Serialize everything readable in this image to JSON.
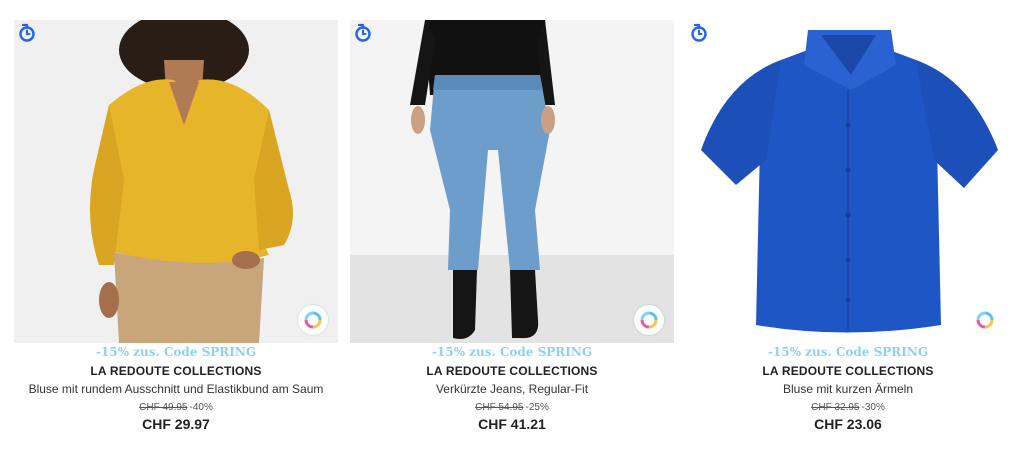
{
  "colors": {
    "accent_blue": "#2563eb",
    "promo_blue": "#8fd0f2"
  },
  "products": [
    {
      "promo": "-15% zus. Code SPRING",
      "brand": "LA REDOUTE COLLECTIONS",
      "title": "Bluse mit rundem Ausschnitt und Elastikbund am Saum",
      "old_price": "CHF 49.95",
      "discount": "-40%",
      "price": "CHF 29.97",
      "icons": [
        "refresh-timer-icon",
        "color-swatch-icon"
      ]
    },
    {
      "promo": "-15% zus. Code SPRING",
      "brand": "LA REDOUTE COLLECTIONS",
      "title": "Verkürzte Jeans, Regular-Fit",
      "old_price": "CHF 54.95",
      "discount": "-25%",
      "price": "CHF 41.21",
      "icons": [
        "refresh-timer-icon",
        "color-swatch-icon"
      ]
    },
    {
      "promo": "-15% zus. Code SPRING",
      "brand": "LA REDOUTE COLLECTIONS",
      "title": "Bluse mit kurzen Ärmeln",
      "old_price": "CHF 32.95",
      "discount": "-30%",
      "price": "CHF 23.06",
      "icons": [
        "refresh-timer-icon",
        "color-swatch-icon"
      ]
    }
  ]
}
